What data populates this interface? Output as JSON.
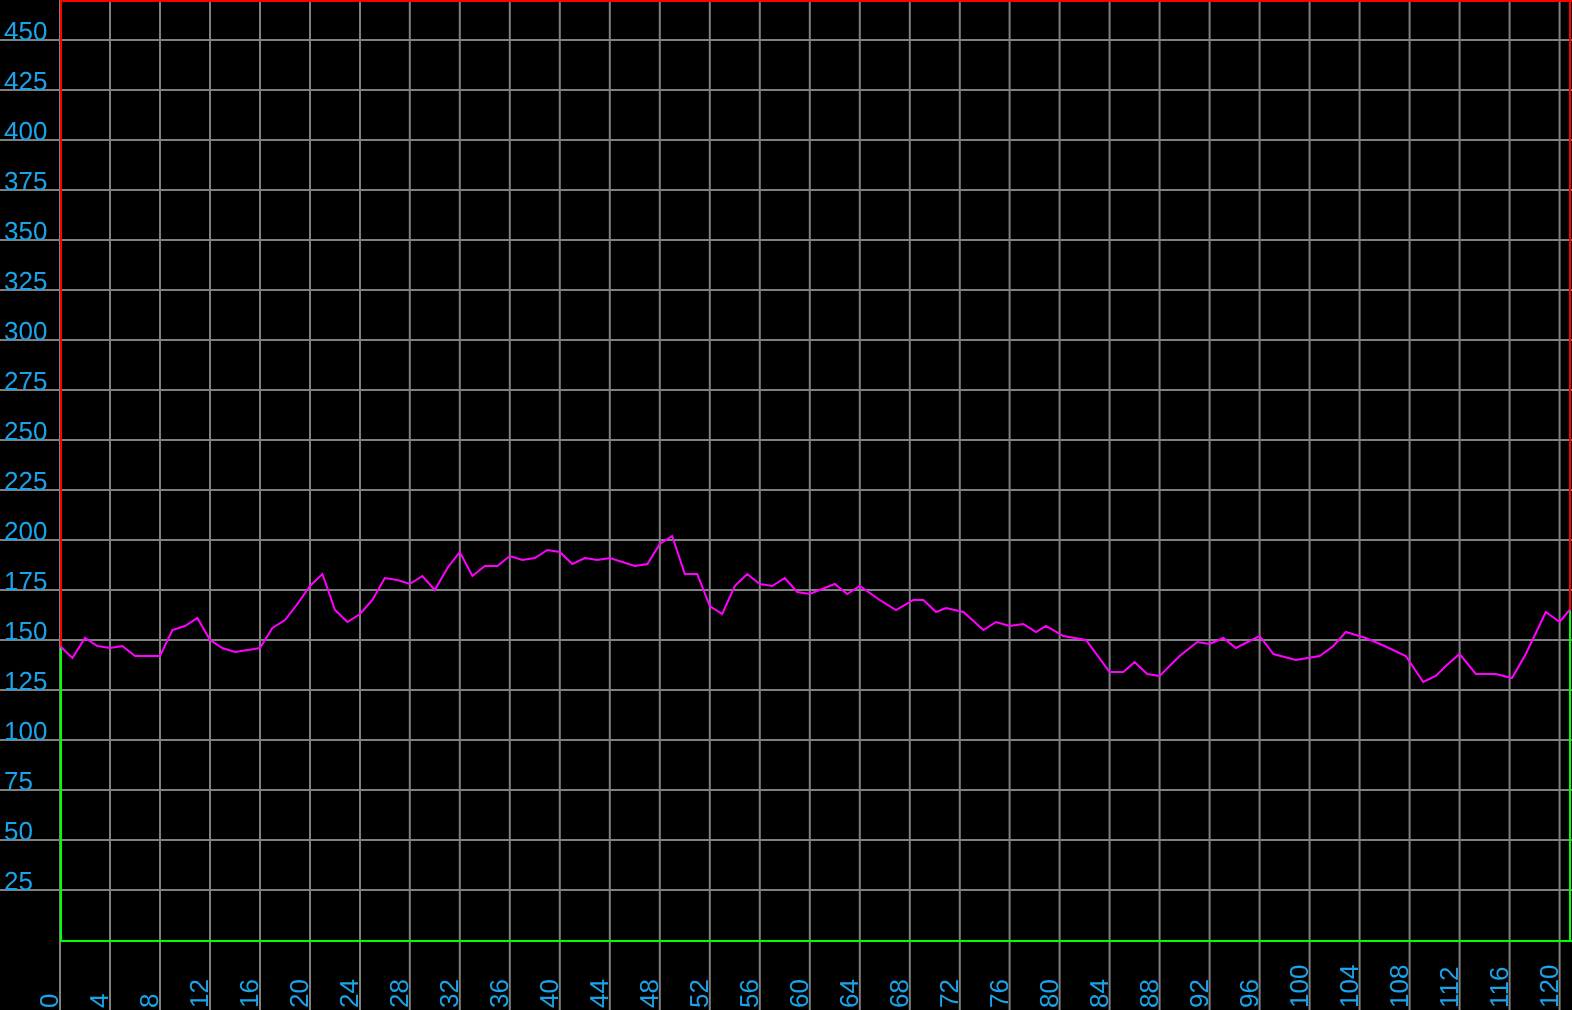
{
  "chart_data": {
    "type": "line",
    "x": [
      0,
      1,
      2,
      3,
      4,
      5,
      6,
      8,
      9,
      10,
      11,
      12,
      13,
      14,
      16,
      17,
      18,
      19,
      20,
      21,
      22,
      23,
      24,
      25,
      26,
      27,
      28,
      29,
      30,
      31,
      32,
      33,
      34,
      35,
      36,
      37,
      38,
      39,
      40,
      41,
      42,
      43,
      44,
      45,
      46,
      47,
      48,
      49,
      50,
      51,
      52,
      53,
      54,
      55,
      56,
      57,
      58,
      59,
      60,
      62,
      63,
      64,
      65.6,
      66.9,
      68.3,
      69.1,
      70.1,
      70.9,
      72.3,
      73.9,
      74.9,
      76,
      77.1,
      78.1,
      78.9,
      80.3,
      82.1,
      84,
      85.1,
      86,
      87,
      88,
      89.6,
      91,
      92,
      93.1,
      94.1,
      96,
      97.1,
      98.9,
      100.8,
      101.9,
      102.9,
      104.5,
      106,
      107.7,
      109.1,
      110.1,
      110.9,
      112,
      113.3,
      114.9,
      116.2,
      117.3,
      118.9,
      120,
      120.8
    ],
    "series": [
      {
        "color": "#ff00ff",
        "values": [
          147,
          141,
          151,
          147,
          146,
          147,
          142,
          142,
          155,
          157,
          161,
          150,
          146,
          144,
          146,
          156,
          160,
          168,
          177,
          183,
          165,
          159,
          163,
          170,
          181,
          180,
          178,
          182,
          175,
          186,
          194,
          182,
          187,
          187,
          192,
          190,
          191,
          195,
          194,
          188,
          191,
          190,
          191,
          189,
          187,
          188,
          198,
          202,
          183,
          183,
          167,
          163,
          177,
          183,
          178,
          177,
          181,
          174,
          173,
          178,
          173,
          177,
          170,
          165,
          170,
          170,
          164,
          166,
          164,
          155,
          159,
          157,
          158,
          154,
          157,
          152,
          150,
          134,
          134,
          139,
          133,
          132,
          142,
          149,
          148,
          151,
          146,
          152,
          143,
          140,
          142,
          147,
          154,
          151,
          147,
          142,
          129,
          132,
          137,
          143,
          133,
          133,
          131,
          143,
          164,
          159,
          165
        ]
      }
    ],
    "grid": true,
    "xlim": [
      0,
      121
    ],
    "ylim": [
      0,
      470
    ],
    "xticks": [
      0,
      4,
      8,
      12,
      16,
      20,
      24,
      28,
      32,
      36,
      40,
      44,
      48,
      52,
      56,
      60,
      64,
      68,
      72,
      76,
      80,
      84,
      88,
      92,
      96,
      100,
      104,
      108,
      112,
      116,
      120
    ],
    "yticks": [
      25,
      50,
      75,
      100,
      125,
      150,
      175,
      200,
      225,
      250,
      275,
      300,
      325,
      350,
      375,
      400,
      425,
      450
    ]
  }
}
